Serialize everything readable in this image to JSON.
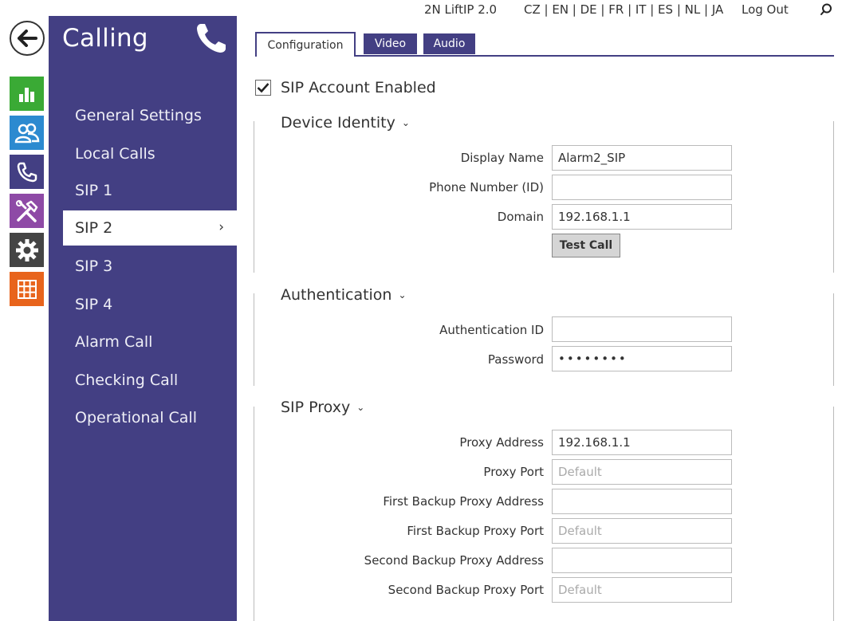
{
  "header": {
    "device": "2N LiftIP 2.0",
    "languages": "CZ | EN | DE | FR | IT | ES | NL | JA",
    "logout": "Log Out"
  },
  "rail": {
    "icons": [
      "back-arrow-icon",
      "status-chart-icon",
      "directory-users-icon",
      "calling-phone-icon",
      "hardware-tools-icon",
      "system-gear-icon",
      "services-grid-icon"
    ],
    "colors": {
      "status": "#3aaa35",
      "directory": "#2c8ad0",
      "calling": "#433f83",
      "hardware": "#8e4aa6",
      "system": "#444444",
      "services": "#e8641c"
    }
  },
  "sidebar": {
    "title": "Calling",
    "icon": "phone-icon",
    "items": [
      {
        "label": "General Settings"
      },
      {
        "label": "Local Calls"
      },
      {
        "label": "SIP 1"
      },
      {
        "label": "SIP 2",
        "active": true
      },
      {
        "label": "SIP 3"
      },
      {
        "label": "SIP 4"
      },
      {
        "label": "Alarm Call"
      },
      {
        "label": "Checking Call"
      },
      {
        "label": "Operational Call"
      }
    ],
    "active_chevron": "›"
  },
  "tabs": [
    {
      "label": "Configuration",
      "active": true
    },
    {
      "label": "Video"
    },
    {
      "label": "Audio"
    }
  ],
  "sip_account": {
    "enabled_label": "SIP Account Enabled",
    "checked": true
  },
  "device_identity": {
    "title": "Device Identity",
    "display_name_label": "Display Name",
    "display_name_value": "Alarm2_SIP",
    "phone_number_label": "Phone Number (ID)",
    "phone_number_value": "",
    "domain_label": "Domain",
    "domain_value": "192.168.1.1",
    "test_call_label": "Test Call"
  },
  "authentication": {
    "title": "Authentication",
    "auth_id_label": "Authentication ID",
    "auth_id_value": "",
    "password_label": "Password",
    "password_value": "••••••••"
  },
  "sip_proxy": {
    "title": "SIP Proxy",
    "proxy_address_label": "Proxy Address",
    "proxy_address_value": "192.168.1.1",
    "proxy_port_label": "Proxy Port",
    "proxy_port_placeholder": "Default",
    "first_backup_address_label": "First Backup Proxy Address",
    "first_backup_address_value": "",
    "first_backup_port_label": "First Backup Proxy Port",
    "first_backup_port_placeholder": "Default",
    "second_backup_address_label": "Second Backup Proxy Address",
    "second_backup_address_value": "",
    "second_backup_port_label": "Second Backup Proxy Port",
    "second_backup_port_placeholder": "Default"
  }
}
